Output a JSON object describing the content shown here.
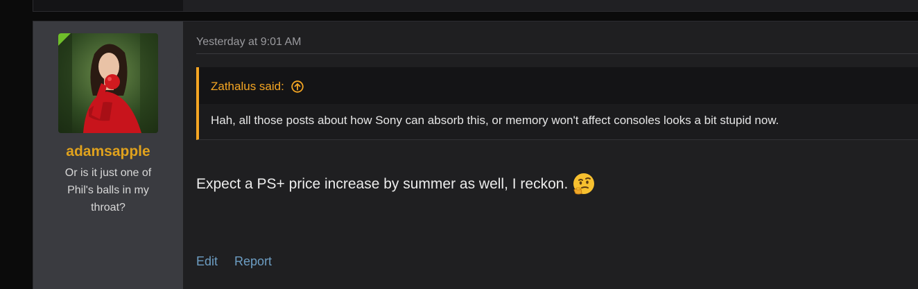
{
  "post": {
    "author": {
      "username": "adamsapple",
      "user_title": "Or is it just one of Phil's balls in my throat?",
      "avatar_icon": "avatar-photo"
    },
    "timestamp": "Yesterday at 9:01 AM",
    "quote": {
      "author_label": "Zathalus said:",
      "jump_icon": "arrow-up-circle-icon",
      "text": "Hah, all those posts about how Sony can absorb this, or memory won't affect consoles looks a bit stupid now."
    },
    "message": "Expect a PS+ price increase by summer as well, I reckon.",
    "emoji_icon": "thinking-face-icon",
    "actions": {
      "edit_label": "Edit",
      "report_label": "Report"
    }
  },
  "colors": {
    "username": "#e0a21d",
    "quote_accent": "#f5a623",
    "link": "#6d9ec4",
    "sidebar_bg": "#3a3b40",
    "post_bg": "#1f1f21"
  }
}
